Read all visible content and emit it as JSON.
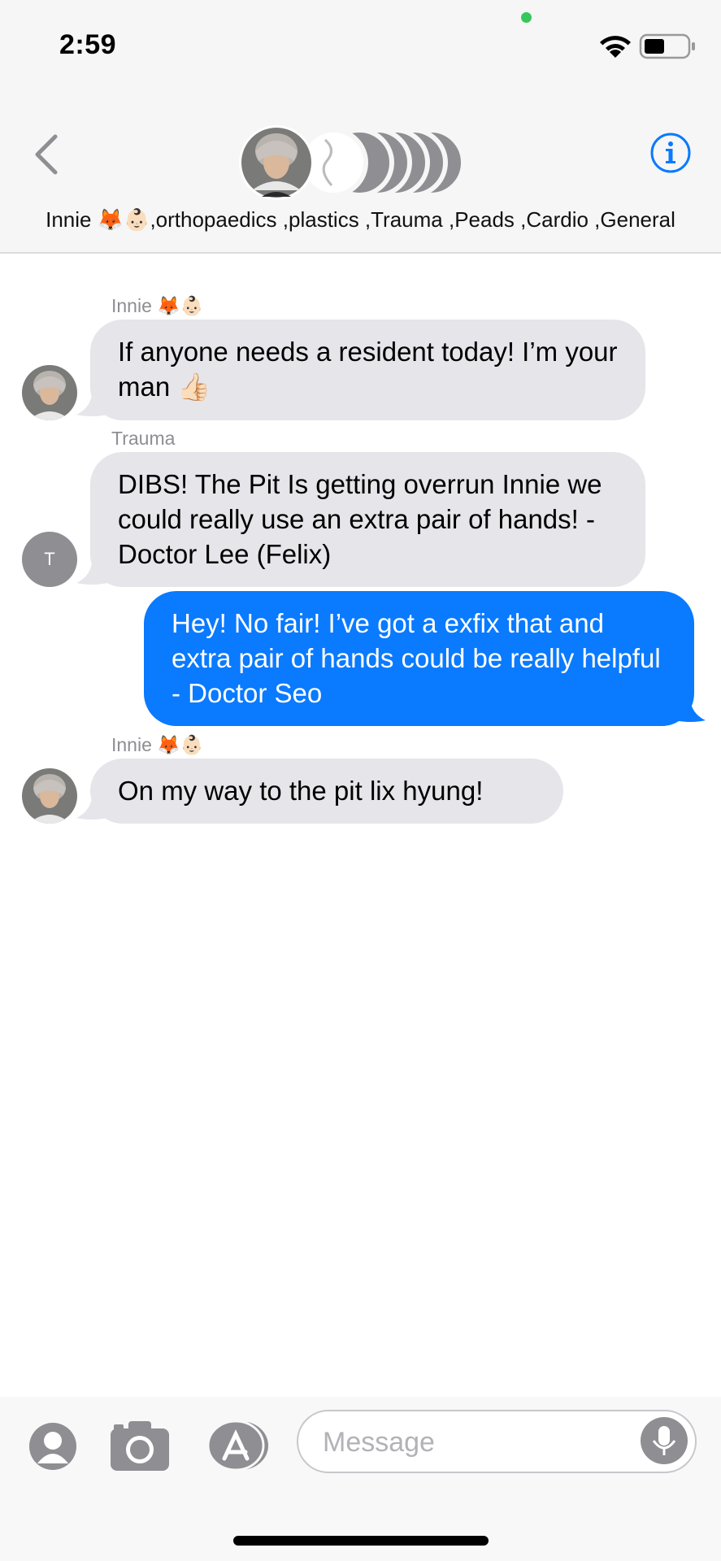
{
  "status_bar": {
    "time": "2:59",
    "icons": [
      "camera-in-use-dot",
      "wifi-icon",
      "battery-icon"
    ]
  },
  "header": {
    "back_icon": "chevron-left-icon",
    "info_icon": "info-icon",
    "group_title": "Innie 🦊👶🏻,orthopaedics ,plastics ,Trauma ,Peads ,Cardio ,General"
  },
  "messages": [
    {
      "sender": "Innie 🦊👶🏻",
      "text": "If anyone needs a resident today! I’m your man 👍🏻",
      "direction": "incoming",
      "avatar": "photo"
    },
    {
      "sender": "Trauma",
      "text": "DIBS! The Pit Is getting overrun Innie we could really use an extra pair of hands! - Doctor Lee (Felix)",
      "direction": "incoming",
      "avatar_initial": "T"
    },
    {
      "text": "Hey! No fair! I’ve got a exfix that and extra pair of hands could be really helpful - Doctor Seo",
      "direction": "outgoing"
    },
    {
      "sender": "Innie 🦊👶🏻",
      "text": "On my way to the pit lix hyung!",
      "direction": "incoming",
      "avatar": "photo"
    }
  ],
  "compose": {
    "placeholder": "Message",
    "buttons": [
      "contact-icon",
      "camera-icon",
      "app-store-icon",
      "microphone-icon"
    ]
  },
  "colors": {
    "outgoing_bubble": "#0a7aff",
    "incoming_bubble": "#e5e5ea",
    "accent": "#0a7aff",
    "status_dot": "#34c759"
  }
}
